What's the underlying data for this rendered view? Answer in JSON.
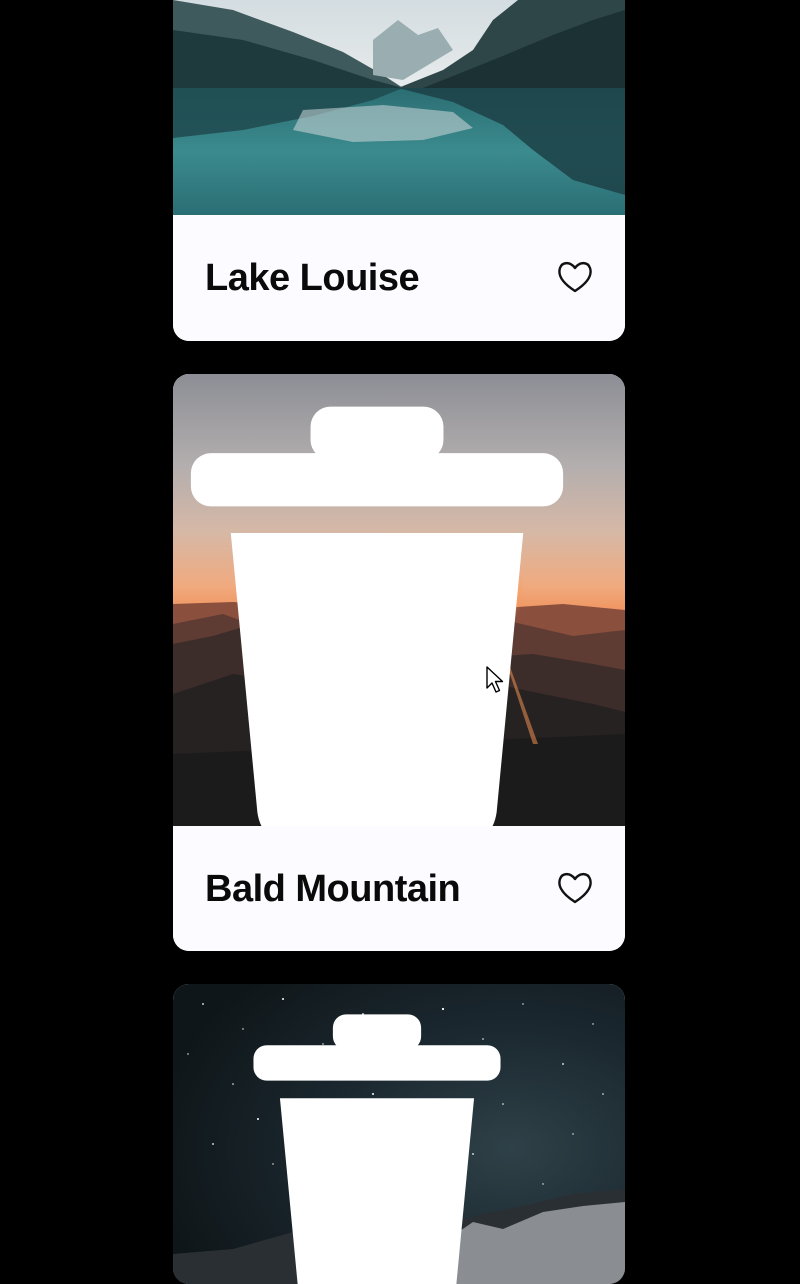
{
  "cards": [
    {
      "title": "Lake Louise",
      "photo_alt": "Lake Louise",
      "icons": {
        "favorite": "heart-outline-icon"
      }
    },
    {
      "title": "Bald Mountain",
      "photo_alt": "Bald Mountain",
      "icons": {
        "delete": "trash-icon",
        "favorite": "heart-outline-icon"
      }
    },
    {
      "title": "",
      "photo_alt": "Starry mountain night",
      "icons": {
        "delete": "trash-icon"
      }
    }
  ],
  "colors": {
    "page_background": "#000000",
    "card_background": "#fcfbff",
    "title_text": "#0a0a0a",
    "icon_light": "#ffffff",
    "icon_dark": "#111111"
  },
  "pointer": {
    "icon": "arrow-cursor-icon"
  }
}
